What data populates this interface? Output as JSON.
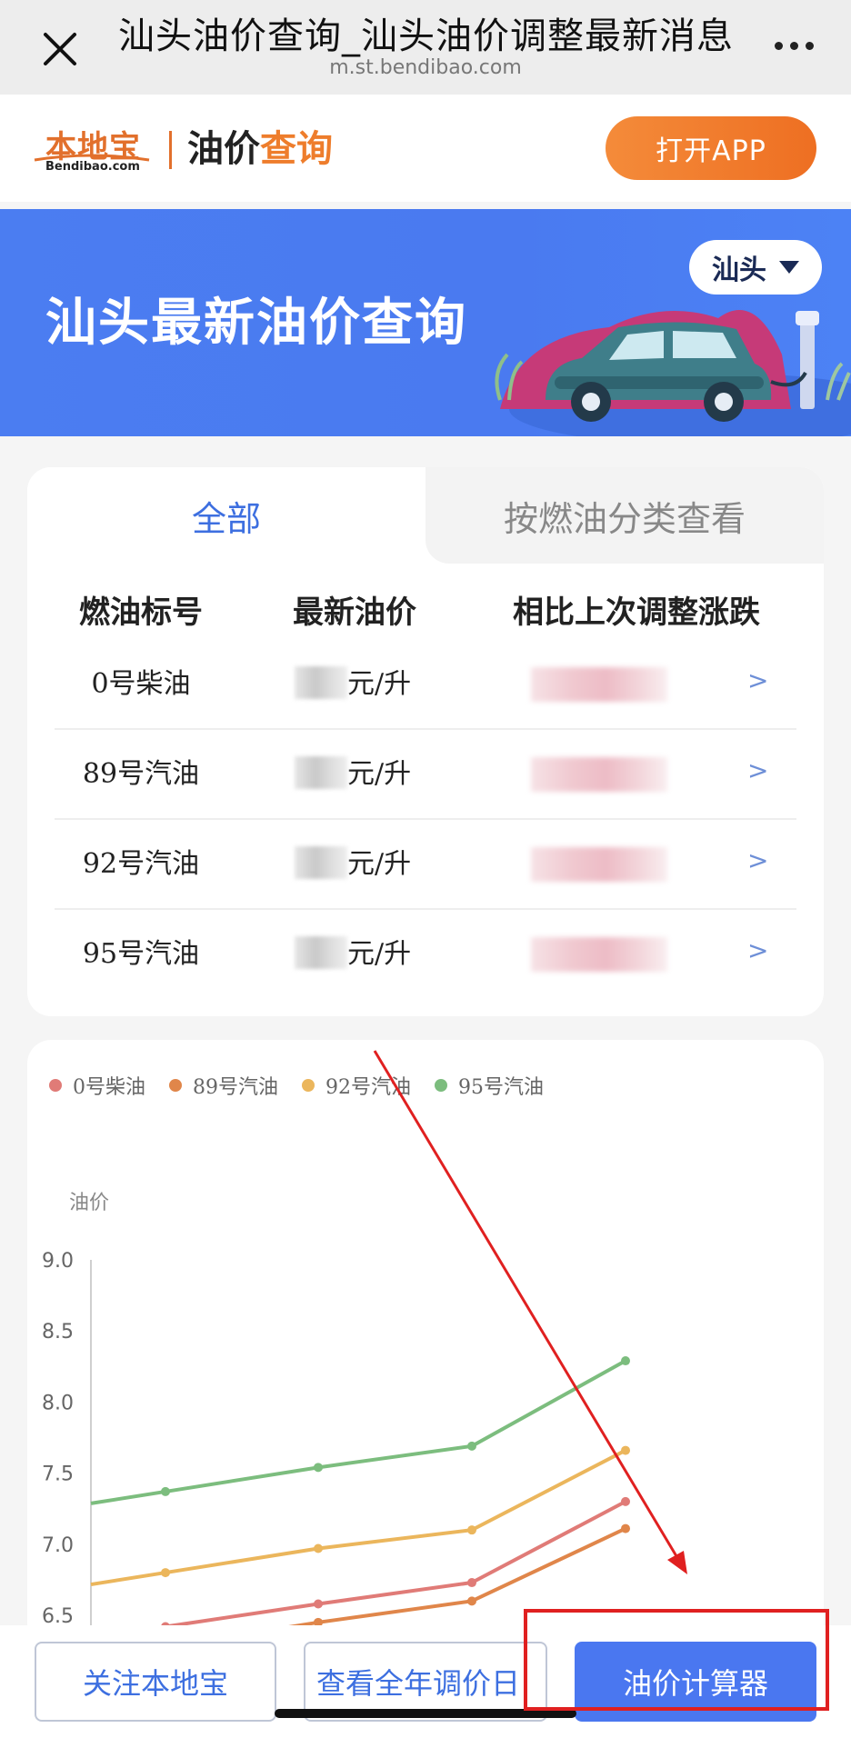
{
  "browser": {
    "title": "汕头油价查询_汕头油价调整最新消息",
    "url": "m.st.bendibao.com"
  },
  "header": {
    "logo_cn": "本地宝",
    "logo_en": "Bendibao.com",
    "title_part1": "油价",
    "title_part2": "查询",
    "open_app_label": "打开APP",
    "accent_color": "#ee7d2c"
  },
  "banner": {
    "title": "汕头最新油价查询",
    "city": "汕头",
    "background_color": "#4b7df1"
  },
  "tabs": [
    {
      "label": "全部",
      "active": true
    },
    {
      "label": "按燃油分类查看",
      "active": false
    }
  ],
  "table": {
    "headers": [
      "燃油标号",
      "最新油价",
      "相比上次调整涨跌"
    ],
    "unit": "元/升",
    "arrow": ">",
    "rows": [
      {
        "name": "0号柴油"
      },
      {
        "name": "89号汽油"
      },
      {
        "name": "92号汽油"
      },
      {
        "name": "95号汽油"
      }
    ]
  },
  "chart_data": {
    "type": "line",
    "ylabel": "油价",
    "ylim": [
      6.5,
      9.0
    ],
    "yticks": [
      "9.0",
      "8.5",
      "8.0",
      "7.5",
      "7.0",
      "6.5"
    ],
    "x_count": 4,
    "legend_position": "top-left",
    "series": [
      {
        "name": "0号柴油",
        "color": "#e07b77",
        "values": [
          6.42,
          6.58,
          6.73,
          7.3
        ]
      },
      {
        "name": "89号汽油",
        "color": "#e0864a",
        "values": [
          6.28,
          6.45,
          6.6,
          7.11
        ]
      },
      {
        "name": "92号汽油",
        "color": "#ebb65c",
        "values": [
          6.8,
          6.97,
          7.1,
          7.66
        ]
      },
      {
        "name": "95号汽油",
        "color": "#7cbd7e",
        "values": [
          7.37,
          7.54,
          7.69,
          8.29
        ]
      }
    ]
  },
  "bottom": {
    "follow_label": "关注本地宝",
    "calendar_label": "查看全年调价日",
    "calculator_label": "油价计算器"
  }
}
